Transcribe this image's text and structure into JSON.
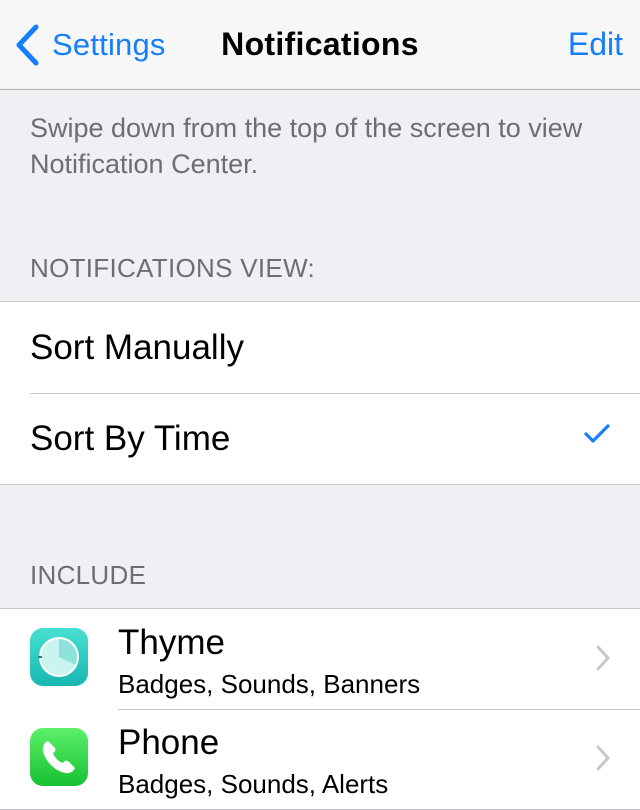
{
  "navbar": {
    "back_label": "Settings",
    "title": "Notifications",
    "edit_label": "Edit"
  },
  "hint": "Swipe down from the top of the screen to view Notification Center.",
  "view_section": {
    "header": "NOTIFICATIONS VIEW:",
    "options": [
      {
        "label": "Sort Manually",
        "selected": false
      },
      {
        "label": "Sort By Time",
        "selected": true
      }
    ]
  },
  "include_section": {
    "header": "INCLUDE",
    "apps": [
      {
        "name": "Thyme",
        "detail": "Badges, Sounds, Banners",
        "icon": "thyme-app-icon"
      },
      {
        "name": "Phone",
        "detail": "Badges, Sounds, Alerts",
        "icon": "phone-app-icon"
      }
    ]
  },
  "colors": {
    "accent": "#157efb",
    "background": "#efeff4",
    "secondary_text": "#6d6d72"
  }
}
